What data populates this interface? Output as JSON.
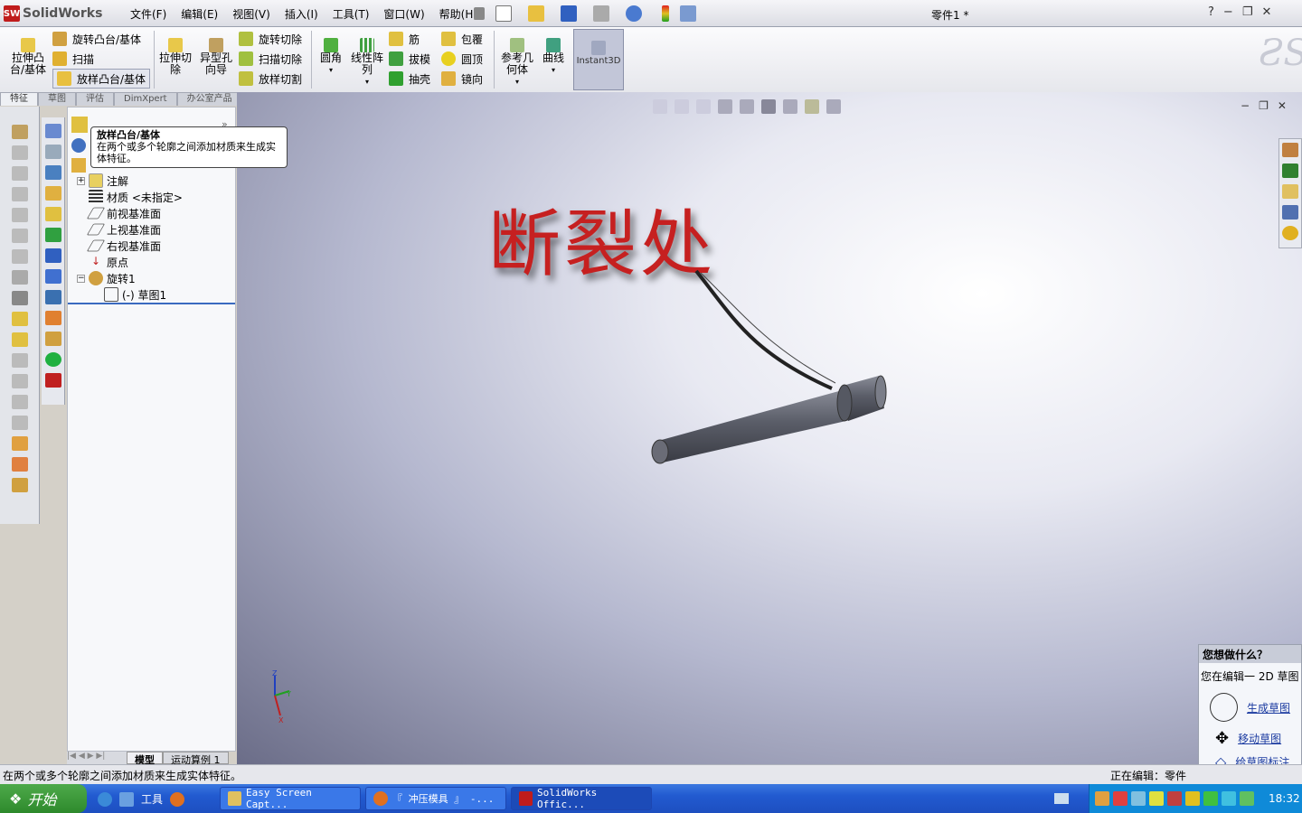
{
  "app": {
    "logo": "SolidWorks",
    "doc_title": "零件1 *"
  },
  "menus": [
    "文件(F)",
    "编辑(E)",
    "视图(V)",
    "插入(I)",
    "工具(T)",
    "窗口(W)",
    "帮助(H)"
  ],
  "window_controls": {
    "help": "?",
    "minimize": "−",
    "restore": "❐",
    "close": "✕"
  },
  "ribbon": {
    "extrude_boss": "拉伸凸台/基体",
    "revolve_boss": "旋转凸台/基体",
    "sweep": "扫描",
    "loft_boss": "放样凸台/基体",
    "extrude_cut": "拉伸切除",
    "hole_wizard": "异型孔向导",
    "revolve_cut": "旋转切除",
    "sweep_cut": "扫描切除",
    "loft_cut": "放样切割",
    "fillet": "圆角",
    "linear_pattern": "线性阵列",
    "rib": "筋",
    "draft": "拔模",
    "shell": "抽壳",
    "wrap": "包覆",
    "dome": "圆顶",
    "mirror": "镜向",
    "ref_geometry": "参考几何体",
    "curves": "曲线",
    "instant3d": "Instant3D"
  },
  "tabs": [
    "特征",
    "草图",
    "评估",
    "DimXpert",
    "办公室产品"
  ],
  "tooltip": {
    "title": "放样凸台/基体",
    "body": "在两个或多个轮廓之间添加材质来生成实体特征。"
  },
  "tree": [
    {
      "label": "注解"
    },
    {
      "label": "材质 <未指定>"
    },
    {
      "label": "前视基准面"
    },
    {
      "label": "上视基准面"
    },
    {
      "label": "右视基准面"
    },
    {
      "label": "原点"
    },
    {
      "label": "旋转1"
    },
    {
      "label": "(-) 草图1"
    }
  ],
  "overlay_text": "断裂处",
  "bottom_tabs": [
    "模型",
    "运动算例 1"
  ],
  "status": {
    "left": "在两个或多个轮廓之间添加材质来生成实体特征。",
    "right": "正在编辑：零件"
  },
  "help_panel": {
    "title": "您想做什么？",
    "subtitle": "您在编辑一 2D 草图",
    "items": [
      "生成草图",
      "移动草图",
      "给草图标注"
    ]
  },
  "taskbar": {
    "start": "开始",
    "tools": "工具",
    "tasks": [
      "Easy Screen Capt...",
      "『 冲压模具 』 -...",
      "SolidWorks Offic..."
    ],
    "clock": "18:32"
  },
  "triad": {
    "x": "X",
    "y": "Y",
    "z": "Z"
  }
}
